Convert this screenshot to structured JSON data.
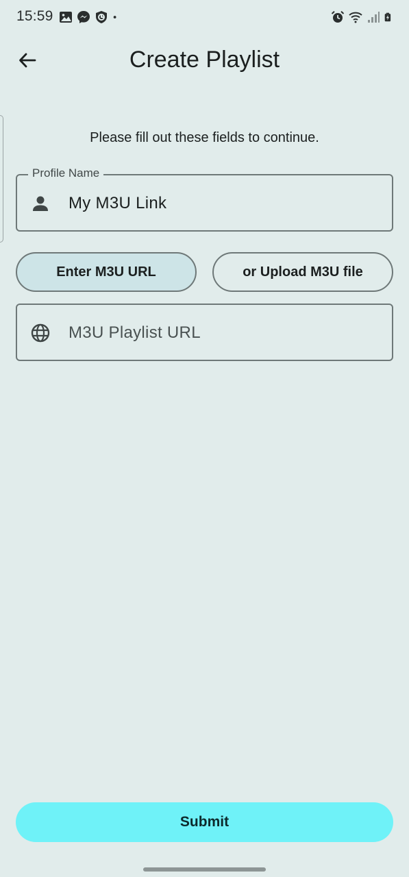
{
  "status_bar": {
    "time": "15:59",
    "left_icons": [
      "gallery-icon",
      "messenger-icon",
      "shield-icon",
      "dot-icon"
    ],
    "right_icons": [
      "alarm-icon",
      "wifi-icon",
      "signal-icon",
      "battery-icon"
    ]
  },
  "app_bar": {
    "title": "Create Playlist",
    "back_icon": "arrow-back-icon"
  },
  "form": {
    "instructions": "Please fill out these fields to continue.",
    "profile_name": {
      "label": "Profile Name",
      "value": "My M3U Link",
      "icon": "person-icon"
    },
    "source_toggle": {
      "options": [
        "Enter M3U URL",
        "or Upload M3U file"
      ],
      "selected": "Enter M3U URL"
    },
    "playlist_url": {
      "placeholder": "M3U Playlist URL",
      "icon": "globe-icon"
    }
  },
  "submit_label": "Submit",
  "colors": {
    "background": "#e1eceb",
    "selected_toggle": "#cde4e7",
    "submit_button": "#6ff2f8",
    "outline": "#6e7878"
  }
}
